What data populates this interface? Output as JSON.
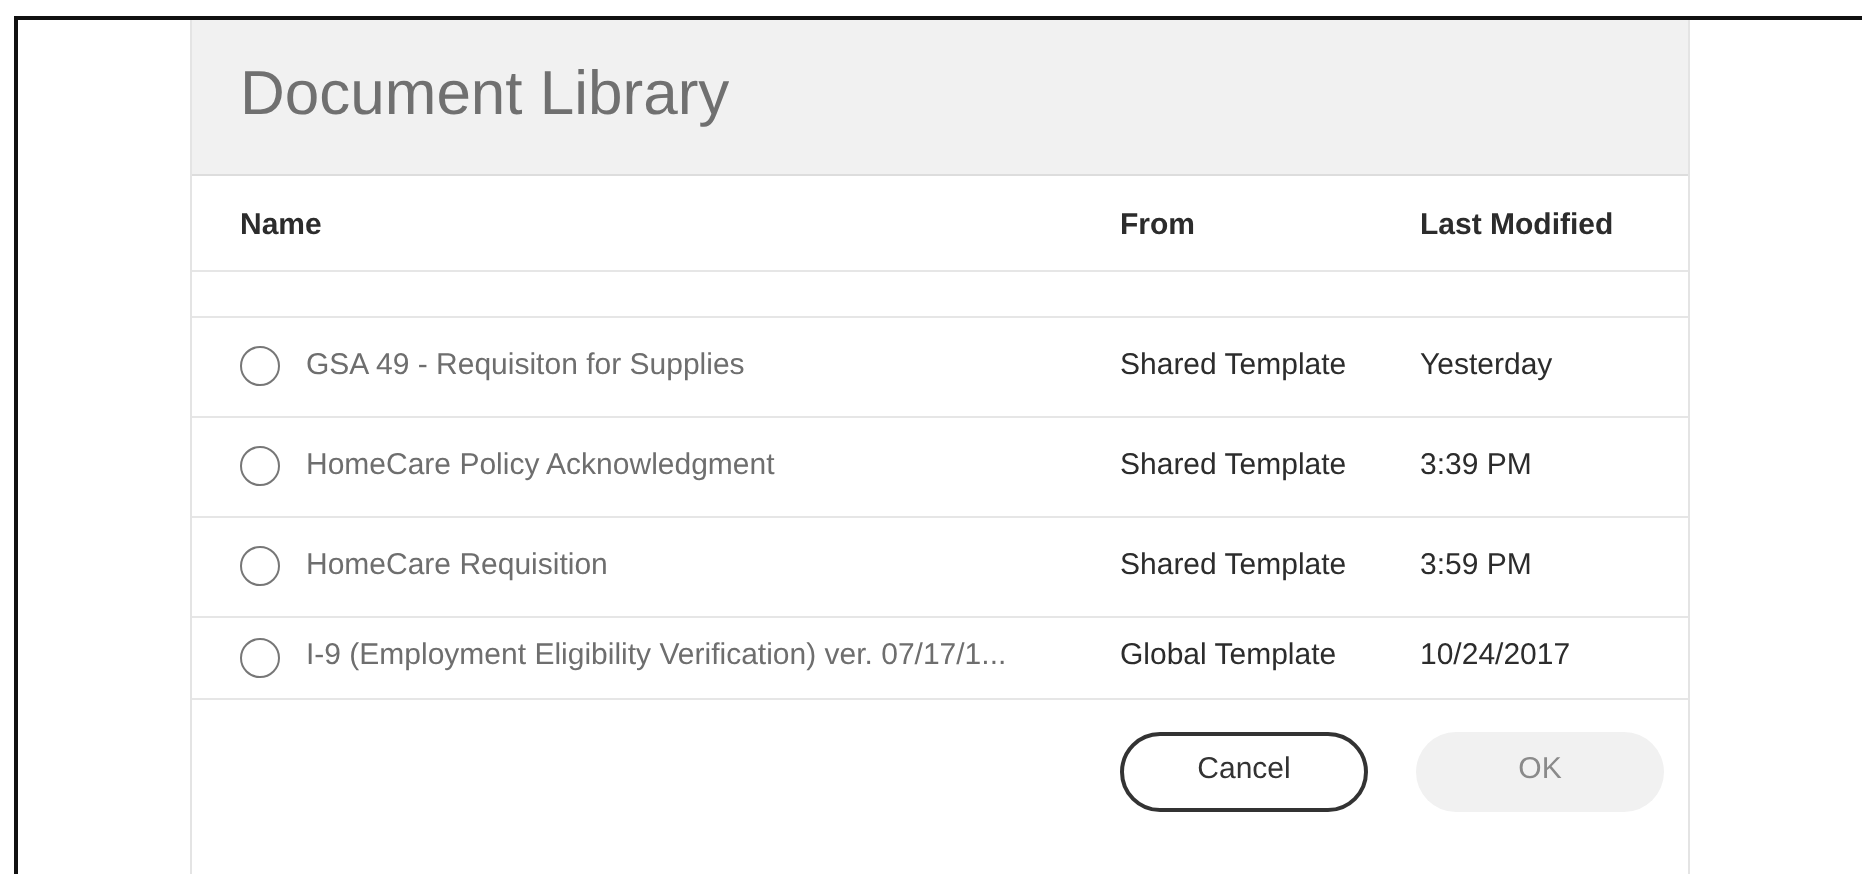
{
  "dialog": {
    "title": "Document Library"
  },
  "table": {
    "columns": [
      "Name",
      "From",
      "Last Modified"
    ],
    "rows": [
      {
        "name": "GSA 49 - Requisiton for Supplies",
        "from": "Shared Template",
        "modified": "Yesterday",
        "selected": false
      },
      {
        "name": "HomeCare Policy Acknowledgment",
        "from": "Shared Template",
        "modified": "3:39 PM",
        "selected": false
      },
      {
        "name": "HomeCare Requisition",
        "from": "Shared Template",
        "modified": "3:59 PM",
        "selected": false
      },
      {
        "name": "I-9 (Employment Eligibility Verification) ver. 07/17/1...",
        "from": "Global Template",
        "modified": "10/24/2017",
        "selected": false
      }
    ]
  },
  "buttons": [
    {
      "label": "Cancel",
      "disabled": false
    },
    {
      "label": "OK",
      "disabled": true
    }
  ]
}
